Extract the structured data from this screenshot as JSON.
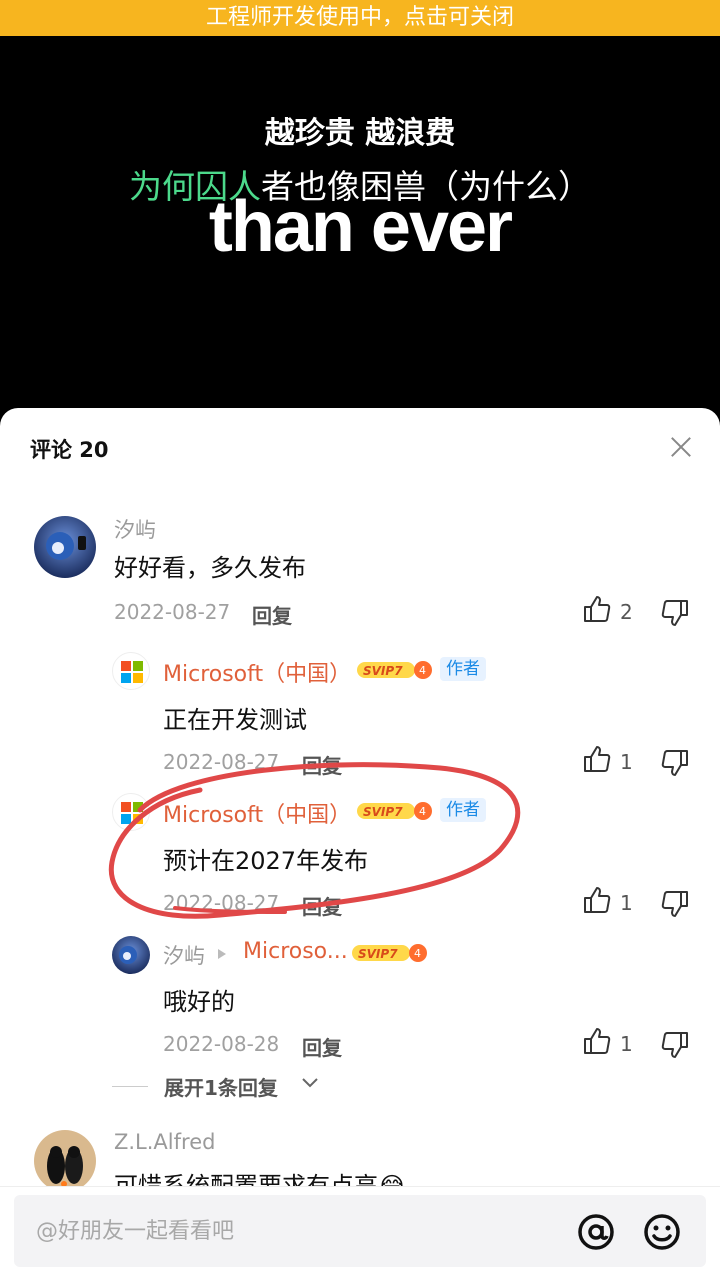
{
  "dev_banner": "工程师开发使用中，点击可关闭",
  "video": {
    "lyric_line1": "越珍贵 越浪费",
    "lyric_line2_highlight": "为何囚人",
    "lyric_line2_rest": "者也像困兽（为什么）",
    "lyric_big": "than ever"
  },
  "comments_panel": {
    "title": "评论 20",
    "reply_label": "回复",
    "comments": [
      {
        "user": "汐屿",
        "text": "好好看，多久发布",
        "date": "2022-08-27",
        "likes": "2"
      },
      {
        "user": "Microsoft（中国）",
        "badge": "SVIP7",
        "author_tag": "作者",
        "text": "正在开发测试",
        "date": "2022-08-27",
        "likes": "1"
      },
      {
        "user": "Microsoft（中国）",
        "badge": "SVIP7",
        "author_tag": "作者",
        "text": "预计在2027年发布",
        "date": "2022-08-27",
        "likes": "1"
      },
      {
        "user": "汐屿",
        "reply_to": "Microso...",
        "badge": "SVIP7",
        "text": "哦好的",
        "date": "2022-08-28",
        "likes": "1"
      },
      {
        "user": "Z.L.Alfred",
        "text": "可惜系统配置要求有点高😂"
      }
    ],
    "expand_replies": "展开1条回复"
  },
  "input": {
    "placeholder": "@好朋友一起看看吧"
  },
  "colors": {
    "banner": "#f7b51f",
    "microsoft_name": "#e0603a",
    "author_tag_bg": "#e7f2ff",
    "author_tag_text": "#1c8be6",
    "annotation_red": "#e04848"
  },
  "icons": [
    "close-icon",
    "thumbs-up-icon",
    "thumbs-down-icon",
    "chevron-down-icon",
    "at-icon",
    "smile-icon",
    "windows-logo-icon"
  ]
}
